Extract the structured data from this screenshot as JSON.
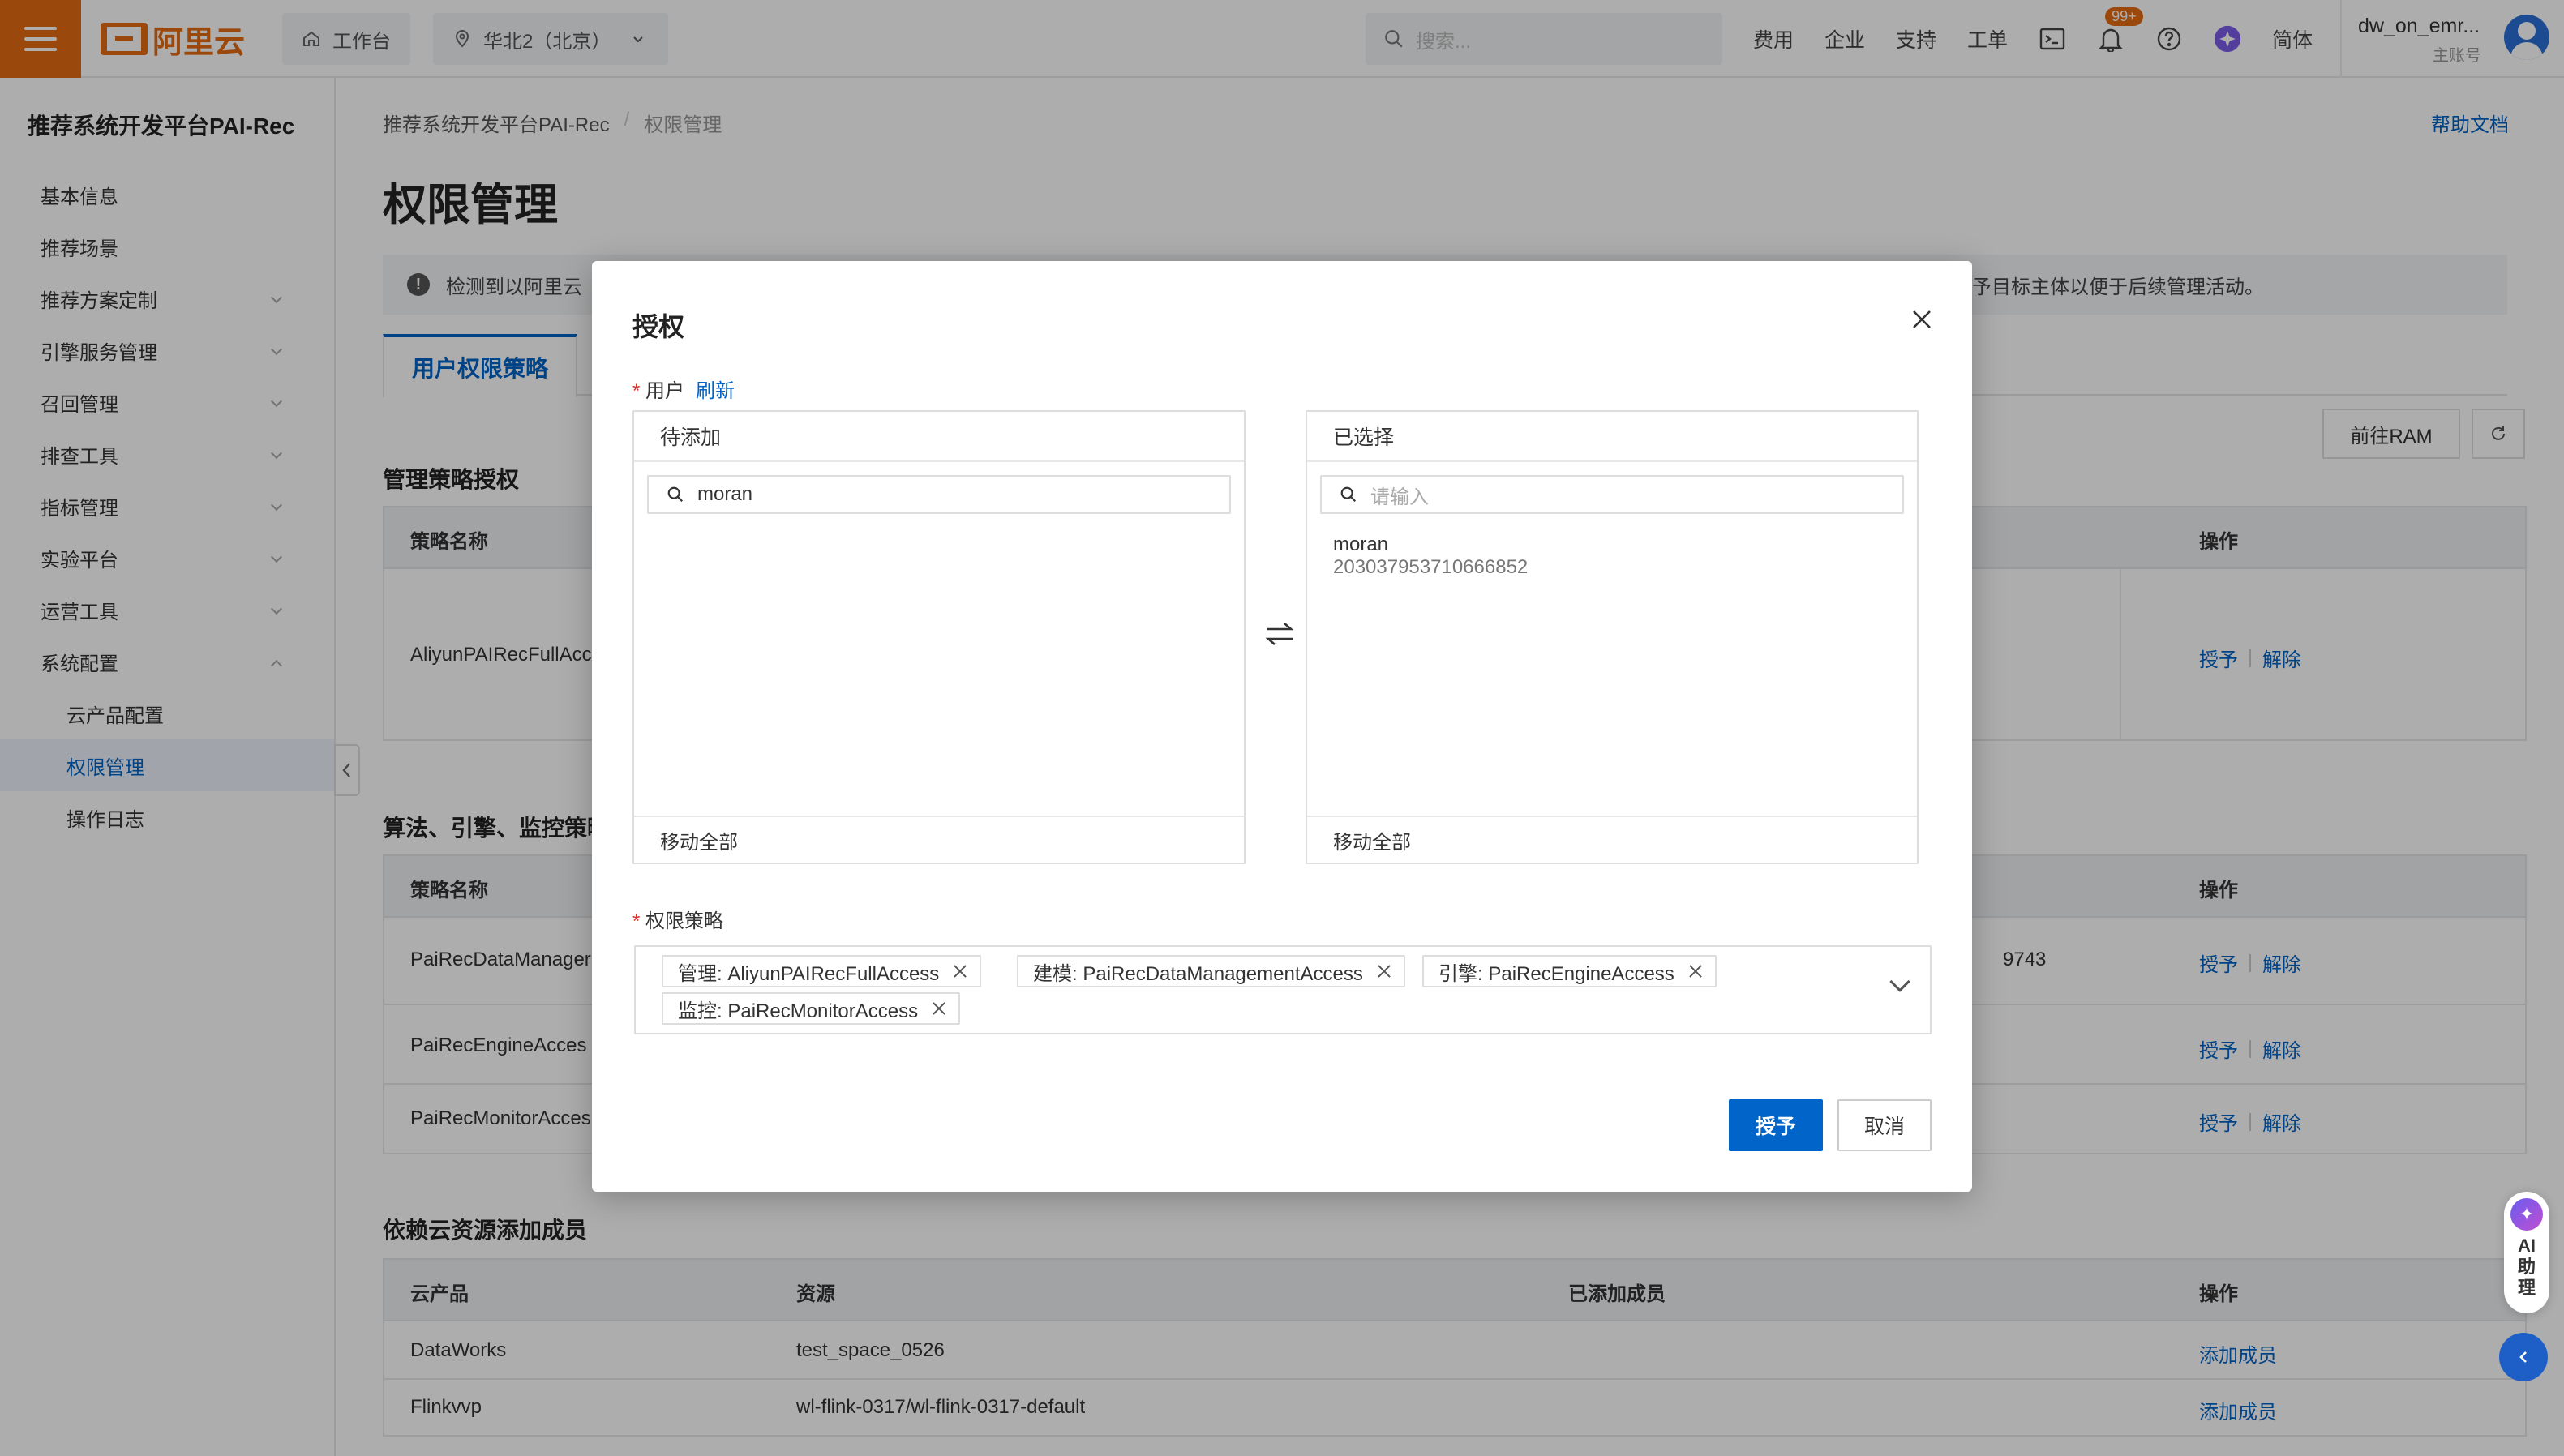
{
  "topbar": {
    "workbench": "工作台",
    "region": "华北2（北京）",
    "search_placeholder": "搜索...",
    "links": [
      "费用",
      "企业",
      "支持",
      "工单"
    ],
    "notification_badge": "99+",
    "lang": "简体",
    "account_name": "dw_on_emr...",
    "account_type": "主账号",
    "logo_text": "阿里云"
  },
  "sidebar": {
    "title": "推荐系统开发平台PAI-Rec",
    "items": [
      {
        "label": "基本信息"
      },
      {
        "label": "推荐场景"
      },
      {
        "label": "推荐方案定制"
      },
      {
        "label": "引擎服务管理"
      },
      {
        "label": "召回管理"
      },
      {
        "label": "排查工具"
      },
      {
        "label": "指标管理"
      },
      {
        "label": "实验平台"
      },
      {
        "label": "运营工具"
      },
      {
        "label": "系统配置"
      },
      {
        "label": "云产品配置"
      },
      {
        "label": "权限管理"
      },
      {
        "label": "操作日志"
      }
    ]
  },
  "page": {
    "breadcrumb": [
      "推荐系统开发平台PAI-Rec",
      "权限管理"
    ],
    "breadcrumb_sep": "/",
    "help": "帮助文档",
    "title": "权限管理",
    "notice_head": "检测到以阿里云",
    "notice_tail": "予目标主体以便于后续管理活动。",
    "tab": "用户权限策略",
    "btn_ram": "前往RAM",
    "section1": "管理策略授权",
    "section2": "算法、引擎、监控策略",
    "section3": "依赖云资源添加成员",
    "col_policy": "策略名称",
    "col_ops": "操作",
    "grant": "授予",
    "revoke": "解除",
    "table1_rows": [
      {
        "name": "AliyunPAIRecFullAcc"
      }
    ],
    "table2_rows": [
      {
        "name": "PaiRecDataManager",
        "right": "9743"
      },
      {
        "name": "PaiRecEngineAcces",
        "right": ""
      },
      {
        "name": "PaiRecMonitorAcces",
        "right": ""
      }
    ],
    "table3_headers": [
      "云产品",
      "资源",
      "已添加成员",
      "操作"
    ],
    "table3_rows": [
      {
        "product": "DataWorks",
        "resource": "test_space_0526",
        "members": "",
        "op": "添加成员"
      },
      {
        "product": "Flinkvvp",
        "resource": "wl-flink-0317/wl-flink-0317-default",
        "members": "",
        "op": "添加成员"
      }
    ]
  },
  "modal": {
    "title": "授权",
    "user_label": "用户",
    "refresh": "刷新",
    "left_panel": {
      "title": "待添加",
      "search_value": "moran",
      "footer": "移动全部"
    },
    "right_panel": {
      "title": "已选择",
      "search_placeholder": "请输入",
      "footer": "移动全部",
      "items": [
        {
          "name": "moran",
          "id": "203037953710666852"
        }
      ]
    },
    "policy_label": "权限策略",
    "policies": [
      "管理: AliyunPAIRecFullAccess",
      "建模: PaiRecDataManagementAccess",
      "引擎: PaiRecEngineAccess",
      "监控: PaiRecMonitorAccess"
    ],
    "ok": "授予",
    "cancel": "取消"
  },
  "ai_assistant": {
    "label": "AI助理"
  },
  "colors": {
    "brand": "#e56b12",
    "primary": "#0064c8"
  }
}
